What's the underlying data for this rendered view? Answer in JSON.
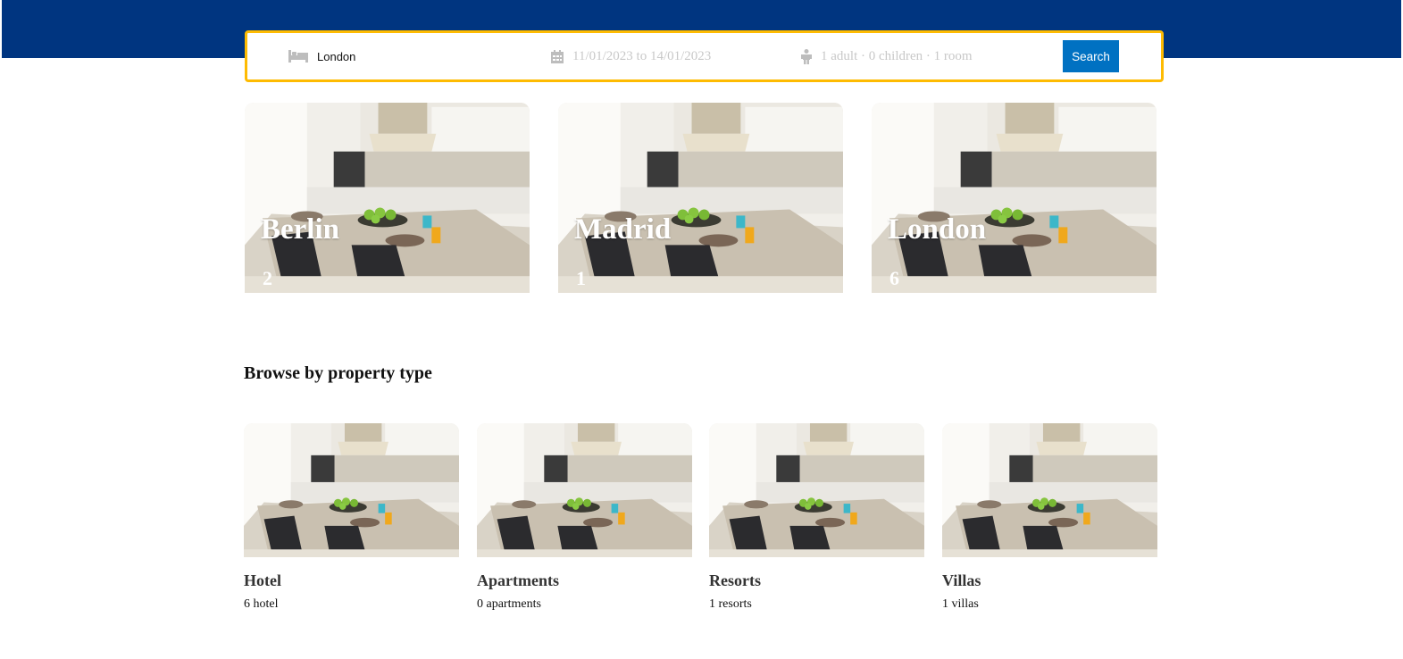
{
  "colors": {
    "header_bg": "#003580",
    "search_border": "#febb02",
    "search_button_bg": "#0071c2",
    "placeholder_text": "#c8c8c8"
  },
  "search": {
    "destination": "London",
    "destination_icon": "bed-icon",
    "dates": "11/01/2023 to 14/01/2023",
    "dates_icon": "calendar-icon",
    "guests": "1 adult · 0 children · 1 room",
    "guests_icon": "person-icon",
    "button_label": "Search"
  },
  "cities": [
    {
      "name": "Berlin",
      "count": "2"
    },
    {
      "name": "Madrid",
      "count": "1"
    },
    {
      "name": "London",
      "count": "6"
    }
  ],
  "browse": {
    "title": "Browse by property type",
    "types": [
      {
        "name": "Hotel",
        "count": "6 hotel"
      },
      {
        "name": "Apartments",
        "count": "0 apartments"
      },
      {
        "name": "Resorts",
        "count": "1 resorts"
      },
      {
        "name": "Villas",
        "count": "1 villas"
      }
    ]
  }
}
